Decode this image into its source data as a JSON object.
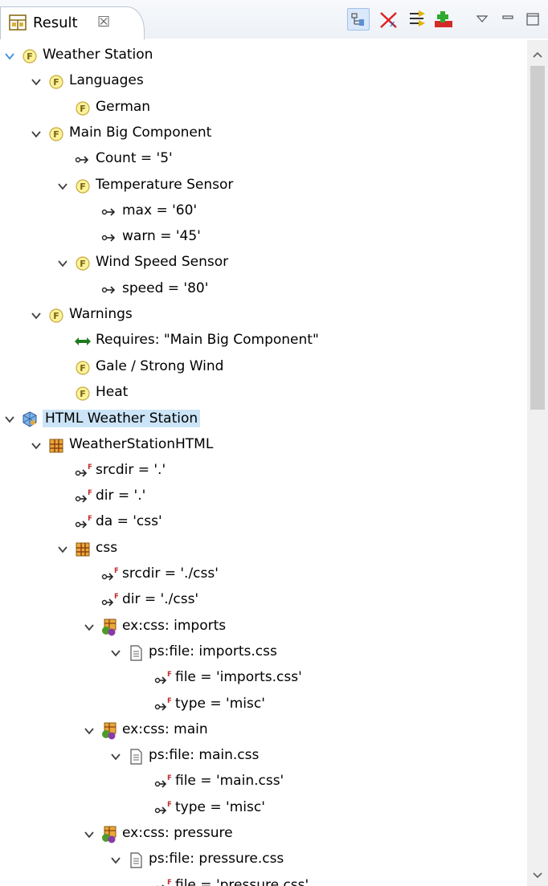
{
  "view": {
    "tab_label": "Result",
    "tab_close": "☒"
  },
  "toolbar": {
    "buttons": [
      {
        "name": "collapse-all-icon",
        "active": true
      },
      {
        "name": "remove-filter-icon",
        "active": false
      },
      {
        "name": "link-editor-icon",
        "active": false
      },
      {
        "name": "add-icon",
        "active": false
      },
      {
        "name": "view-menu-icon",
        "active": false
      },
      {
        "name": "minimize-icon",
        "active": false
      },
      {
        "name": "maximize-icon",
        "active": false
      }
    ]
  },
  "tree": [
    {
      "label": "Weather Station",
      "icon": "feature",
      "expanded": true,
      "selected": false
    },
    {
      "label": "Languages",
      "icon": "feature",
      "expanded": true
    },
    {
      "label": "German",
      "icon": "feature"
    },
    {
      "label": "Main Big Component",
      "icon": "feature",
      "expanded": true
    },
    {
      "label": "Count = '5'",
      "icon": "attribute"
    },
    {
      "label": "Temperature Sensor",
      "icon": "feature",
      "expanded": true
    },
    {
      "label": "max = '60'",
      "icon": "attribute"
    },
    {
      "label": "warn = '45'",
      "icon": "attribute"
    },
    {
      "label": "Wind Speed Sensor",
      "icon": "feature",
      "expanded": true
    },
    {
      "label": "speed = '80'",
      "icon": "attribute"
    },
    {
      "label": "Warnings",
      "icon": "feature",
      "expanded": true
    },
    {
      "label": "Requires: \"Main Big Component\"",
      "icon": "requires"
    },
    {
      "label": "Gale / Strong Wind",
      "icon": "feature"
    },
    {
      "label": "Heat",
      "icon": "feature"
    },
    {
      "label": "HTML Weather Station",
      "icon": "family-model",
      "expanded": true,
      "selected": true
    },
    {
      "label": "WeatherStationHTML",
      "icon": "component",
      "expanded": true
    },
    {
      "label": "srcdir = '.'",
      "icon": "f-attribute"
    },
    {
      "label": "dir = '.'",
      "icon": "f-attribute"
    },
    {
      "label": "da = 'css'",
      "icon": "f-attribute"
    },
    {
      "label": "css",
      "icon": "component",
      "expanded": true
    },
    {
      "label": "srcdir = './css'",
      "icon": "f-attribute"
    },
    {
      "label": "dir = './css'",
      "icon": "f-attribute"
    },
    {
      "label": "ex:css: imports",
      "icon": "part",
      "expanded": true
    },
    {
      "label": "ps:file: imports.css",
      "icon": "file",
      "expanded": true
    },
    {
      "label": "file = 'imports.css'",
      "icon": "f-attribute"
    },
    {
      "label": "type = 'misc'",
      "icon": "f-attribute"
    },
    {
      "label": "ex:css: main",
      "icon": "part",
      "expanded": true
    },
    {
      "label": "ps:file: main.css",
      "icon": "file",
      "expanded": true
    },
    {
      "label": "file = 'main.css'",
      "icon": "f-attribute"
    },
    {
      "label": "type = 'misc'",
      "icon": "f-attribute"
    },
    {
      "label": "ex:css: pressure",
      "icon": "part",
      "expanded": true
    },
    {
      "label": "ps:file: pressure.css",
      "icon": "file",
      "expanded": true
    },
    {
      "label": "file = 'pressure.css'",
      "icon": "f-attribute"
    }
  ],
  "colors": {
    "selection": "#cce4f7",
    "feature_fill": "#fbf29a",
    "chevron": "#3c78c8"
  }
}
